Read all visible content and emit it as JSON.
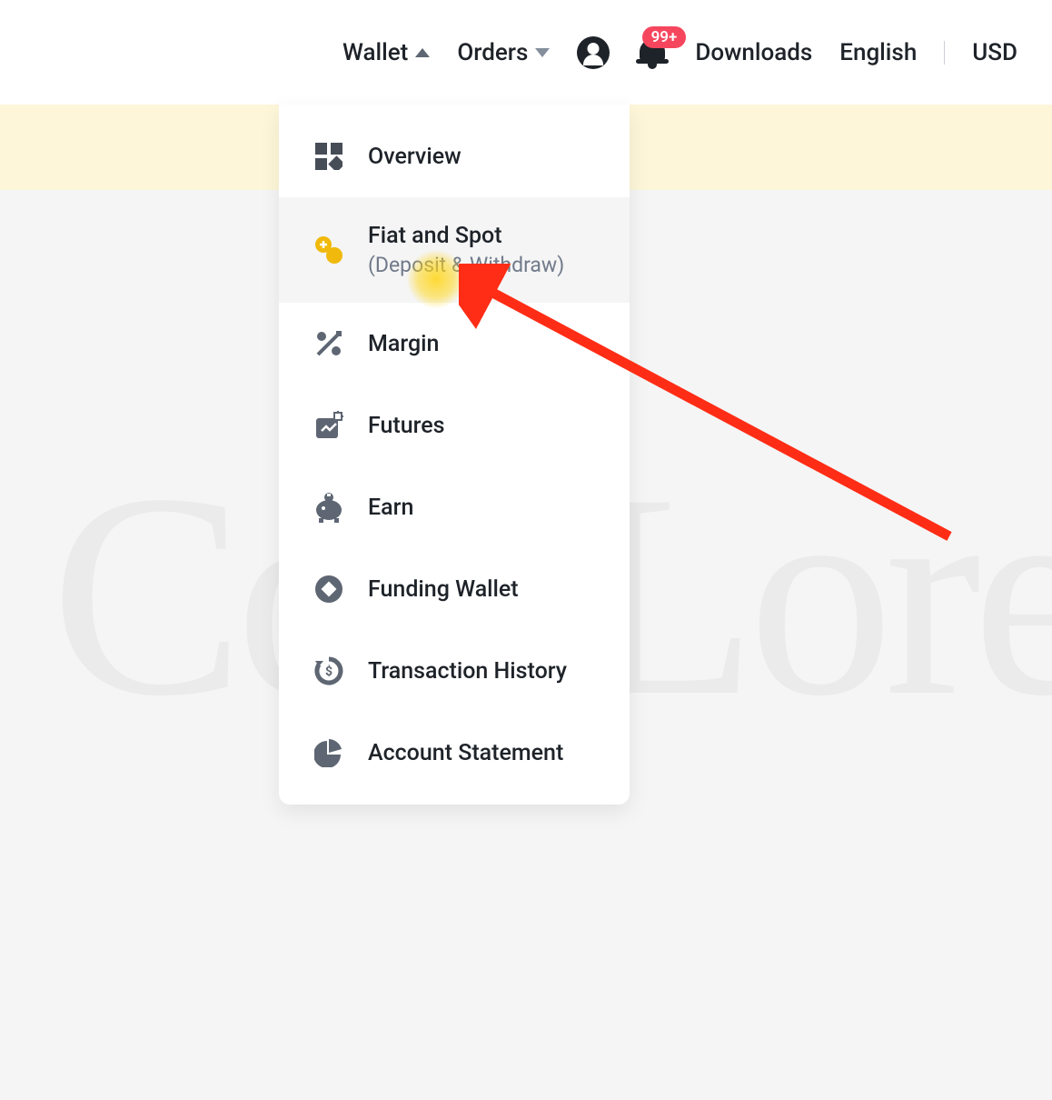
{
  "header": {
    "wallet_label": "Wallet",
    "orders_label": "Orders",
    "downloads_label": "Downloads",
    "language_label": "English",
    "currency_label": "USD",
    "notification_badge": "99+"
  },
  "dropdown": {
    "items": [
      {
        "label": "Overview",
        "icon": "grid-icon"
      },
      {
        "label": "Fiat and Spot",
        "sublabel": "(Deposit & Withdraw)",
        "icon": "exchange-icon",
        "highlighted": true
      },
      {
        "label": "Margin",
        "icon": "percent-icon"
      },
      {
        "label": "Futures",
        "icon": "chart-box-icon"
      },
      {
        "label": "Earn",
        "icon": "piggy-icon"
      },
      {
        "label": "Funding Wallet",
        "icon": "diamond-circle-icon"
      },
      {
        "label": "Transaction History",
        "icon": "history-icon"
      },
      {
        "label": "Account Statement",
        "icon": "pie-icon"
      }
    ]
  },
  "watermark_text": "CoinLore"
}
